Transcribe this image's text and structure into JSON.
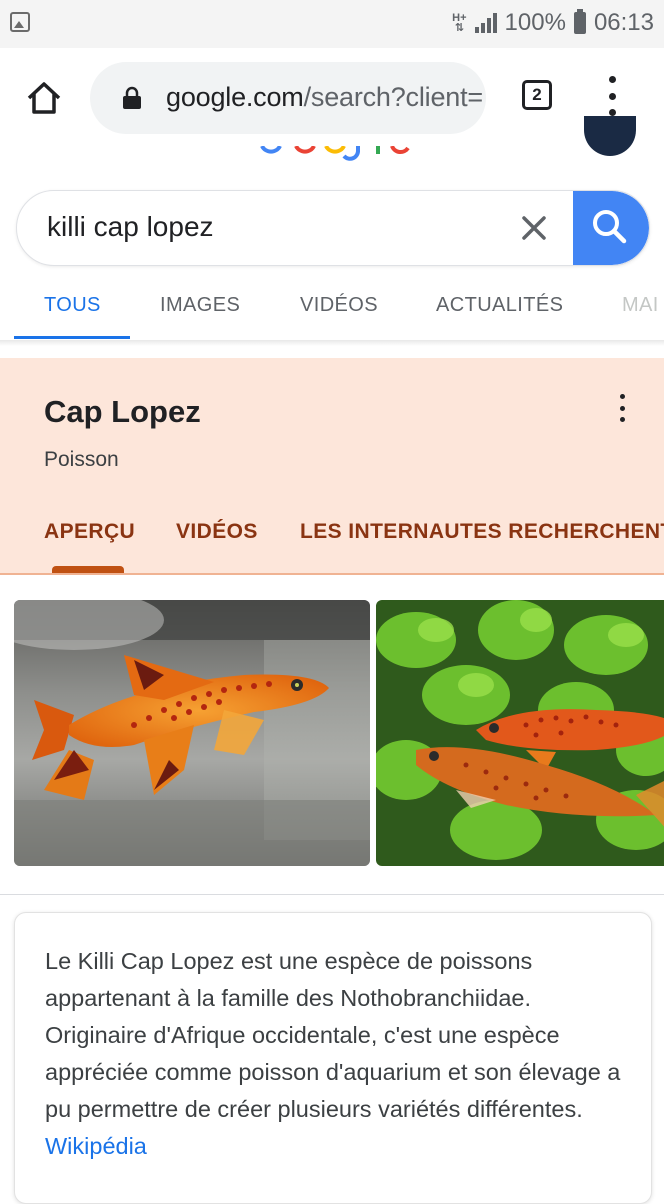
{
  "status_bar": {
    "network": "H+",
    "battery": "100%",
    "time": "06:13"
  },
  "browser": {
    "url_host": "google.com",
    "url_path": "/search?client=",
    "tab_count": "2"
  },
  "search": {
    "query": "killi cap lopez"
  },
  "nav_tabs": [
    {
      "label": "TOUS"
    },
    {
      "label": "IMAGES"
    },
    {
      "label": "VIDÉOS"
    },
    {
      "label": "ACTUALITÉS"
    },
    {
      "label": "MAI"
    }
  ],
  "knowledge_panel": {
    "title": "Cap Lopez",
    "subtitle": "Poisson",
    "tabs": [
      {
        "label": "APERÇU"
      },
      {
        "label": "VIDÉOS"
      },
      {
        "label": "LES INTERNAUTES RECHERCHENT"
      }
    ]
  },
  "description": {
    "text": "Le Killi Cap Lopez est une espèce de poissons appartenant à la famille des Nothobranchiidae. Originaire d'Afrique occidentale, c'est une espèce appréciée comme poisson d'aquarium et son élevage a pu permettre de créer plusieurs variétés différentes.",
    "source_link": "Wikipédia"
  },
  "colors": {
    "accent_blue": "#1a73e8",
    "search_button": "#4285f4",
    "panel_bg": "#fde6da",
    "panel_tab": "#8a3412"
  }
}
